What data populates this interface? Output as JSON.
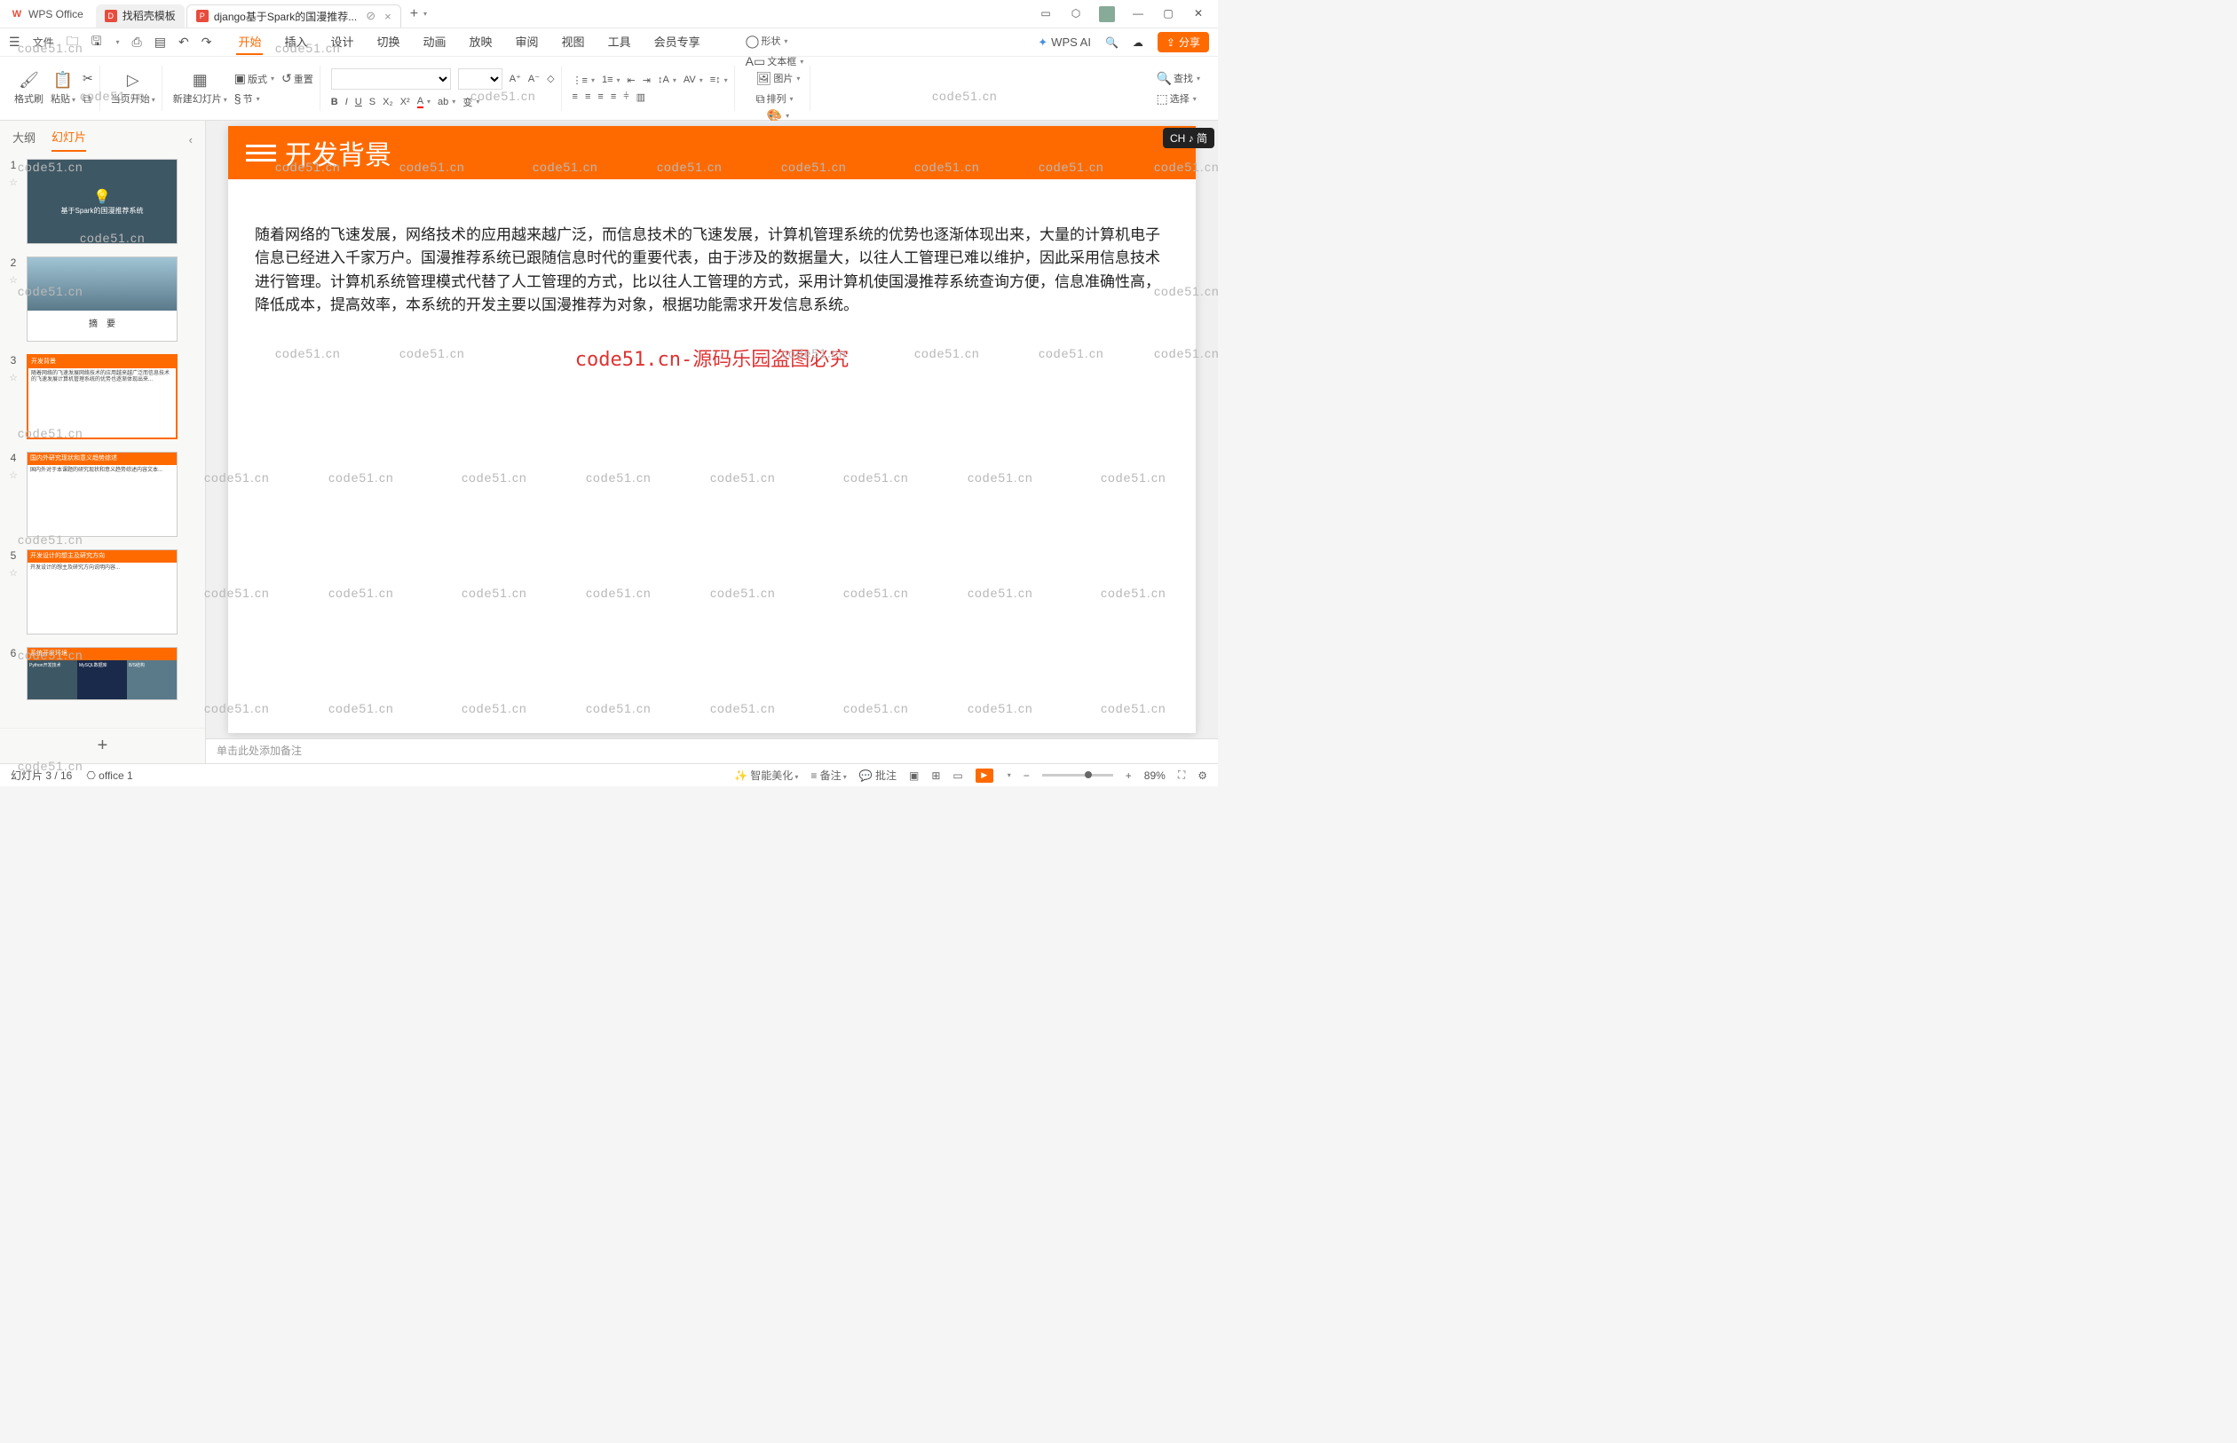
{
  "titlebar": {
    "app_name": "WPS Office",
    "tabs": [
      {
        "label": "找稻壳模板",
        "icon_color": "#e74c3c"
      },
      {
        "label": "django基于Spark的国漫推荐...",
        "icon_letter": "P",
        "icon_bg": "#e74c3c",
        "active": true
      }
    ],
    "add": "+"
  },
  "qa": {
    "file": "文件"
  },
  "menubar": {
    "items": [
      "开始",
      "插入",
      "设计",
      "切换",
      "动画",
      "放映",
      "审阅",
      "视图",
      "工具",
      "会员专享"
    ],
    "active": "开始",
    "wpsai": "WPS AI",
    "share": "分享"
  },
  "ribbon": {
    "format_brush": "格式刷",
    "paste": "粘贴",
    "from_current": "当页开始",
    "new_slide": "新建幻灯片",
    "layout": "版式",
    "section": "节",
    "reset": "重置",
    "shape": "形状",
    "picture": "图片",
    "textbox": "文本框",
    "arrange": "排列",
    "find": "查找",
    "select": "选择"
  },
  "sidepanel": {
    "tabs": [
      "大纲",
      "幻灯片"
    ],
    "active": "幻灯片",
    "slides": [
      {
        "n": 1,
        "kind": "dark",
        "caption": "基于Spark的国漫推荐系统"
      },
      {
        "n": 2,
        "kind": "pic",
        "caption": "摘　要"
      },
      {
        "n": 3,
        "kind": "orange",
        "hdr": "开发背景",
        "active": true
      },
      {
        "n": 4,
        "kind": "orange",
        "hdr": "国内外研究现状和意义趋势综述"
      },
      {
        "n": 5,
        "kind": "orange",
        "hdr": "开发设计的想主及研究方向"
      },
      {
        "n": 6,
        "kind": "orange",
        "hdr": "系统开发环境"
      }
    ],
    "add": "+"
  },
  "slide": {
    "title": "开发背景",
    "body": "随着网络的飞速发展，网络技术的应用越来越广泛，而信息技术的飞速发展，计算机管理系统的优势也逐渐体现出来，大量的计算机电子信息已经进入千家万户。国漫推荐系统已跟随信息时代的重要代表，由于涉及的数据量大，以往人工管理已难以维护，因此采用信息技术进行管理。计算机系统管理模式代替了人工管理的方式，比以往人工管理的方式，采用计算机使国漫推荐系统查询方便，信息准确性高，降低成本，提高效率，本系统的开发主要以国漫推荐为对象，根据功能需求开发信息系统。",
    "watermark_notice": "code51.cn-源码乐园盗图必究"
  },
  "ime": "CH ♪ 简",
  "notes": {
    "placeholder": "单击此处添加备注"
  },
  "status": {
    "slide_counter": "幻灯片 3 / 16",
    "office": "office 1",
    "smart_beautify": "智能美化",
    "notes": "备注",
    "comments": "批注",
    "zoom": "89%"
  },
  "watermark_text": "code51.cn"
}
